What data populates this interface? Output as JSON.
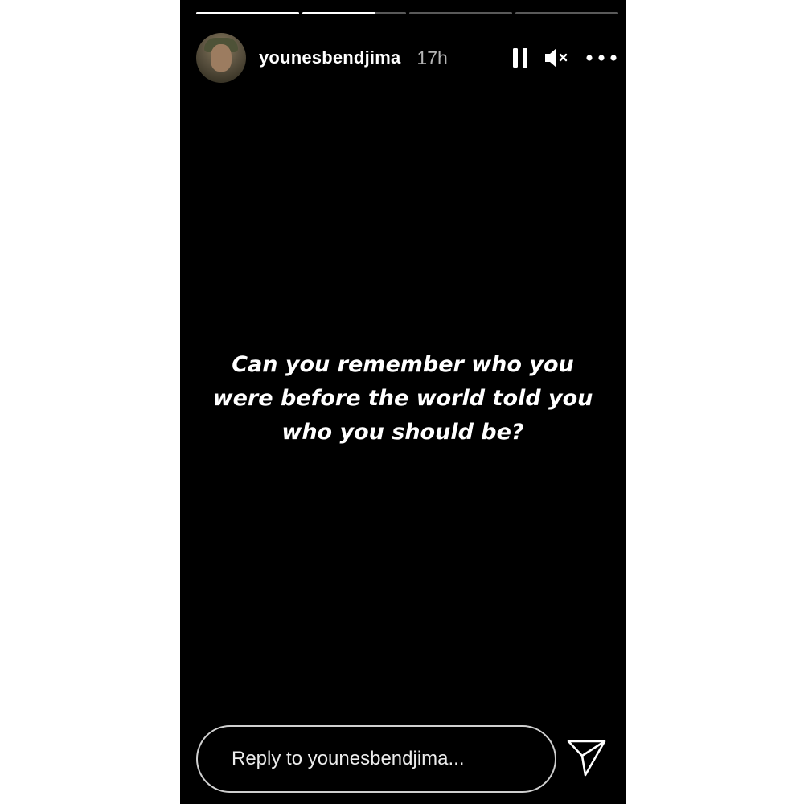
{
  "story": {
    "progress": [
      {
        "fill": 1.0
      },
      {
        "fill": 0.7
      },
      {
        "fill": 0.0
      },
      {
        "fill": 0.0
      }
    ],
    "header": {
      "username": "younesbendjima",
      "time": "17h",
      "icons": {
        "pause": "pause-icon",
        "mute": "muted-speaker-icon",
        "more": "more-options-icon"
      }
    },
    "caption": {
      "line1": "Can you remember who you",
      "line2": "were before the world told you",
      "line3": "who you should be?"
    },
    "reply": {
      "placeholder": "Reply to younesbendjima...",
      "send_icon": "send-icon"
    },
    "colors": {
      "background": "#000000",
      "text": "#ffffff",
      "muted_text": "#b5b5b5"
    }
  }
}
